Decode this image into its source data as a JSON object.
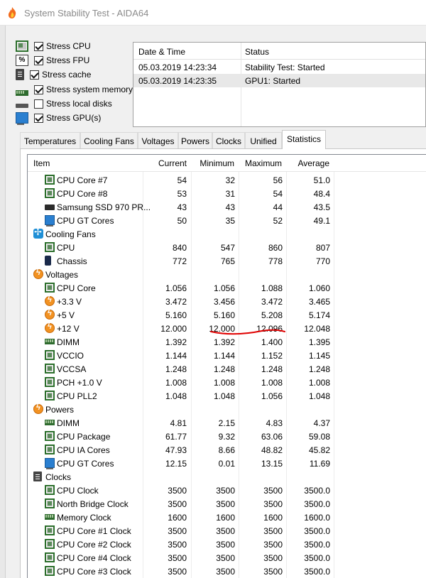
{
  "window": {
    "title": "System Stability Test - AIDA64"
  },
  "stress": [
    {
      "label": "Stress CPU",
      "checked": true,
      "icon": "cpu-chip-icon"
    },
    {
      "label": "Stress FPU",
      "checked": true,
      "icon": "fpu-percent-icon"
    },
    {
      "label": "Stress cache",
      "checked": true,
      "icon": "cache-chip-icon"
    },
    {
      "label": "Stress system memory",
      "checked": true,
      "icon": "memory-module-icon"
    },
    {
      "label": "Stress local disks",
      "checked": false,
      "icon": "disk-drive-icon"
    },
    {
      "label": "Stress GPU(s)",
      "checked": true,
      "icon": "gpu-monitor-icon"
    }
  ],
  "log": {
    "columns": [
      "Date & Time",
      "Status"
    ],
    "rows": [
      {
        "time": "05.03.2019 14:23:34",
        "status": "Stability Test: Started"
      },
      {
        "time": "05.03.2019 14:23:35",
        "status": "GPU1: Started"
      }
    ]
  },
  "tabs": [
    "Temperatures",
    "Cooling Fans",
    "Voltages",
    "Powers",
    "Clocks",
    "Unified",
    "Statistics"
  ],
  "active_tab": "Statistics",
  "stats": {
    "columns": [
      "Item",
      "Current",
      "Minimum",
      "Maximum",
      "Average"
    ],
    "rows": [
      {
        "type": "item",
        "icon": "chip",
        "name": "CPU Core #7",
        "cur": "54",
        "min": "32",
        "max": "56",
        "avg": "51.0"
      },
      {
        "type": "item",
        "icon": "chip",
        "name": "CPU Core #8",
        "cur": "53",
        "min": "31",
        "max": "54",
        "avg": "48.4"
      },
      {
        "type": "item",
        "icon": "ssd",
        "name": "Samsung SSD 970 PR...",
        "cur": "43",
        "min": "43",
        "max": "44",
        "avg": "43.5"
      },
      {
        "type": "item",
        "icon": "gpu",
        "name": "CPU GT Cores",
        "cur": "50",
        "min": "35",
        "max": "52",
        "avg": "49.1"
      },
      {
        "type": "group",
        "icon": "fan",
        "name": "Cooling Fans"
      },
      {
        "type": "item",
        "icon": "chip",
        "name": "CPU",
        "cur": "840",
        "min": "547",
        "max": "860",
        "avg": "807"
      },
      {
        "type": "item",
        "icon": "phone",
        "name": "Chassis",
        "cur": "772",
        "min": "765",
        "max": "778",
        "avg": "770"
      },
      {
        "type": "group",
        "icon": "bolt",
        "name": "Voltages"
      },
      {
        "type": "item",
        "icon": "chip",
        "name": "CPU Core",
        "cur": "1.056",
        "min": "1.056",
        "max": "1.088",
        "avg": "1.060"
      },
      {
        "type": "item",
        "icon": "bolt",
        "name": "+3.3 V",
        "cur": "3.472",
        "min": "3.456",
        "max": "3.472",
        "avg": "3.465"
      },
      {
        "type": "item",
        "icon": "bolt",
        "name": "+5 V",
        "cur": "5.160",
        "min": "5.160",
        "max": "5.208",
        "avg": "5.174"
      },
      {
        "type": "item",
        "icon": "bolt",
        "name": "+12 V",
        "cur": "12.000",
        "min": "12.000",
        "max": "12.096",
        "avg": "12.048"
      },
      {
        "type": "item",
        "icon": "ram",
        "name": "DIMM",
        "cur": "1.392",
        "min": "1.392",
        "max": "1.400",
        "avg": "1.395"
      },
      {
        "type": "item",
        "icon": "chip",
        "name": "VCCIO",
        "cur": "1.144",
        "min": "1.144",
        "max": "1.152",
        "avg": "1.145"
      },
      {
        "type": "item",
        "icon": "chip",
        "name": "VCCSA",
        "cur": "1.248",
        "min": "1.248",
        "max": "1.248",
        "avg": "1.248"
      },
      {
        "type": "item",
        "icon": "chip",
        "name": "PCH +1.0 V",
        "cur": "1.008",
        "min": "1.008",
        "max": "1.008",
        "avg": "1.008"
      },
      {
        "type": "item",
        "icon": "chip",
        "name": "CPU PLL2",
        "cur": "1.048",
        "min": "1.048",
        "max": "1.056",
        "avg": "1.048"
      },
      {
        "type": "group",
        "icon": "bolt",
        "name": "Powers"
      },
      {
        "type": "item",
        "icon": "ram",
        "name": "DIMM",
        "cur": "4.81",
        "min": "2.15",
        "max": "4.83",
        "avg": "4.37"
      },
      {
        "type": "item",
        "icon": "chip",
        "name": "CPU Package",
        "cur": "61.77",
        "min": "9.32",
        "max": "63.06",
        "avg": "59.08"
      },
      {
        "type": "item",
        "icon": "chip",
        "name": "CPU IA Cores",
        "cur": "47.93",
        "min": "8.66",
        "max": "48.82",
        "avg": "45.82"
      },
      {
        "type": "item",
        "icon": "gpu",
        "name": "CPU GT Cores",
        "cur": "12.15",
        "min": "0.01",
        "max": "13.15",
        "avg": "11.69"
      },
      {
        "type": "group",
        "icon": "clock",
        "name": "Clocks"
      },
      {
        "type": "item",
        "icon": "chip",
        "name": "CPU Clock",
        "cur": "3500",
        "min": "3500",
        "max": "3500",
        "avg": "3500.0"
      },
      {
        "type": "item",
        "icon": "chip",
        "name": "North Bridge Clock",
        "cur": "3500",
        "min": "3500",
        "max": "3500",
        "avg": "3500.0"
      },
      {
        "type": "item",
        "icon": "ram",
        "name": "Memory Clock",
        "cur": "1600",
        "min": "1600",
        "max": "1600",
        "avg": "1600.0"
      },
      {
        "type": "item",
        "icon": "chip",
        "name": "CPU Core #1 Clock",
        "cur": "3500",
        "min": "3500",
        "max": "3500",
        "avg": "3500.0"
      },
      {
        "type": "item",
        "icon": "chip",
        "name": "CPU Core #2 Clock",
        "cur": "3500",
        "min": "3500",
        "max": "3500",
        "avg": "3500.0"
      },
      {
        "type": "item",
        "icon": "chip",
        "name": "CPU Core #4 Clock",
        "cur": "3500",
        "min": "3500",
        "max": "3500",
        "avg": "3500.0"
      },
      {
        "type": "item",
        "icon": "chip",
        "name": "CPU Core #3 Clock",
        "cur": "3500",
        "min": "3500",
        "max": "3500",
        "avg": "3500.0"
      }
    ]
  },
  "annotation_color": "#e00000"
}
